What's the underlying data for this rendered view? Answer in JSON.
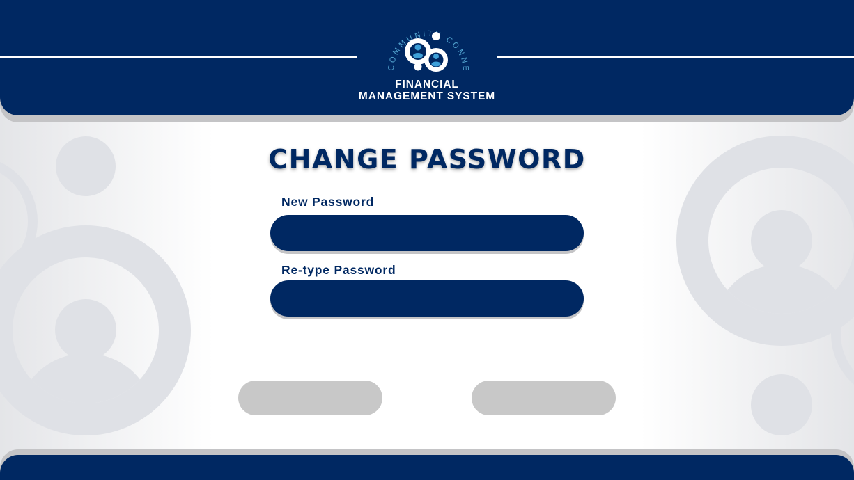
{
  "header": {
    "logo_text": "COMMUNITY CONNECT",
    "app_title_line1": "FINANCIAL",
    "app_title_line2": "MANAGEMENT SYSTEM"
  },
  "page": {
    "title": "CHANGE PASSWORD"
  },
  "form": {
    "new_password_label": "New Password",
    "new_password_value": "",
    "retype_password_label": "Re-type Password",
    "retype_password_value": ""
  },
  "buttons": {
    "left_label": "",
    "right_label": ""
  },
  "colors": {
    "primary_navy": "#002862",
    "button_gray": "#c8c8c8",
    "decor_gray": "#dfe1e6",
    "logo_accent": "#3fa0d8",
    "logo_ring_text": "#4f9fcc"
  }
}
